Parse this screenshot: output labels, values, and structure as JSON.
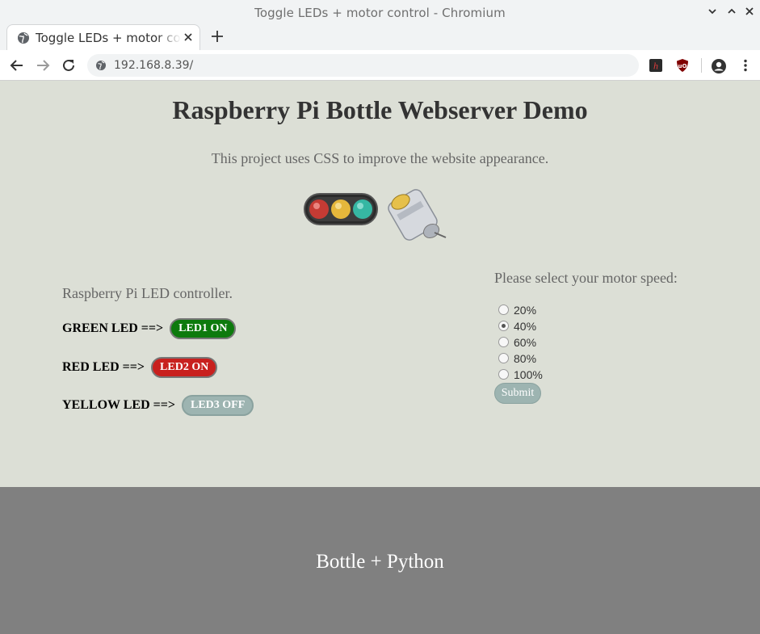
{
  "window": {
    "title": "Toggle LEDs + motor control - Chromium"
  },
  "tabs": [
    {
      "label": "Toggle LEDs + motor control"
    }
  ],
  "address_bar": {
    "url": "192.168.8.39/"
  },
  "icons": {
    "tab": "globe-icon",
    "back": "back-arrow-icon",
    "forward": "forward-arrow-icon",
    "reload": "reload-icon",
    "site_info": "site-info-icon",
    "extensions": [
      "h-extension-icon",
      "ublock-icon"
    ],
    "profile": "profile-icon",
    "menu": "kebab-menu-icon"
  },
  "page": {
    "title": "Raspberry Pi Bottle Webserver Demo",
    "subtitle": "This project uses CSS to improve the website appearance.",
    "led_section": {
      "heading": "Raspberry Pi LED controller.",
      "rows": [
        {
          "label": "GREEN LED ==>",
          "button": "LED1 ON",
          "color": "#0d7a0d"
        },
        {
          "label": "RED LED ==>",
          "button": "LED2 ON",
          "color": "#c8201e"
        },
        {
          "label": "YELLOW LED ==>",
          "button": "LED3 OFF",
          "color": "#9db4b1"
        }
      ]
    },
    "motor_section": {
      "heading": "Please select your motor speed:",
      "options": [
        "20%",
        "40%",
        "60%",
        "80%",
        "100%"
      ],
      "selected": "40%",
      "submit_label": "Submit"
    }
  },
  "footer": {
    "text": "Bottle + Python"
  }
}
